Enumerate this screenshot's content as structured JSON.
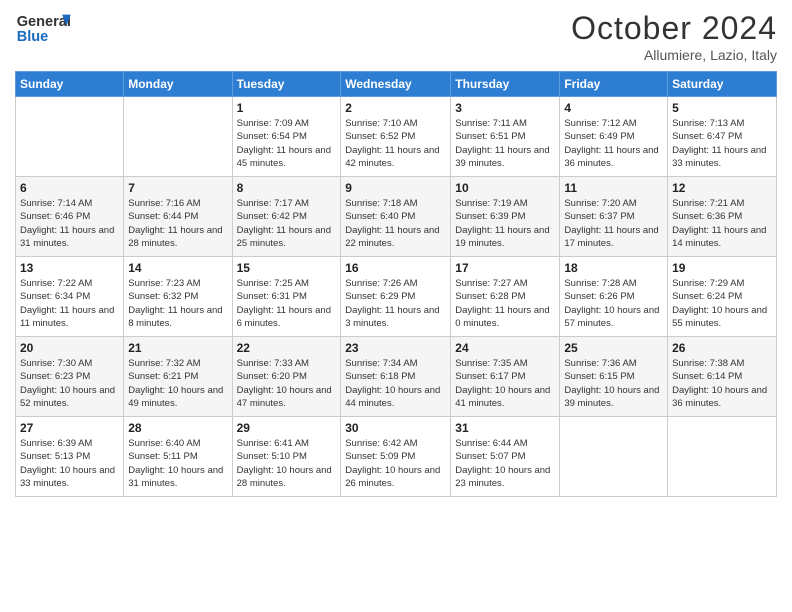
{
  "logo": {
    "line1": "General",
    "line2": "Blue"
  },
  "title": "October 2024",
  "subtitle": "Allumiere, Lazio, Italy",
  "weekdays": [
    "Sunday",
    "Monday",
    "Tuesday",
    "Wednesday",
    "Thursday",
    "Friday",
    "Saturday"
  ],
  "weeks": [
    [
      {
        "day": "",
        "info": ""
      },
      {
        "day": "",
        "info": ""
      },
      {
        "day": "1",
        "info": "Sunrise: 7:09 AM\nSunset: 6:54 PM\nDaylight: 11 hours and 45 minutes."
      },
      {
        "day": "2",
        "info": "Sunrise: 7:10 AM\nSunset: 6:52 PM\nDaylight: 11 hours and 42 minutes."
      },
      {
        "day": "3",
        "info": "Sunrise: 7:11 AM\nSunset: 6:51 PM\nDaylight: 11 hours and 39 minutes."
      },
      {
        "day": "4",
        "info": "Sunrise: 7:12 AM\nSunset: 6:49 PM\nDaylight: 11 hours and 36 minutes."
      },
      {
        "day": "5",
        "info": "Sunrise: 7:13 AM\nSunset: 6:47 PM\nDaylight: 11 hours and 33 minutes."
      }
    ],
    [
      {
        "day": "6",
        "info": "Sunrise: 7:14 AM\nSunset: 6:46 PM\nDaylight: 11 hours and 31 minutes."
      },
      {
        "day": "7",
        "info": "Sunrise: 7:16 AM\nSunset: 6:44 PM\nDaylight: 11 hours and 28 minutes."
      },
      {
        "day": "8",
        "info": "Sunrise: 7:17 AM\nSunset: 6:42 PM\nDaylight: 11 hours and 25 minutes."
      },
      {
        "day": "9",
        "info": "Sunrise: 7:18 AM\nSunset: 6:40 PM\nDaylight: 11 hours and 22 minutes."
      },
      {
        "day": "10",
        "info": "Sunrise: 7:19 AM\nSunset: 6:39 PM\nDaylight: 11 hours and 19 minutes."
      },
      {
        "day": "11",
        "info": "Sunrise: 7:20 AM\nSunset: 6:37 PM\nDaylight: 11 hours and 17 minutes."
      },
      {
        "day": "12",
        "info": "Sunrise: 7:21 AM\nSunset: 6:36 PM\nDaylight: 11 hours and 14 minutes."
      }
    ],
    [
      {
        "day": "13",
        "info": "Sunrise: 7:22 AM\nSunset: 6:34 PM\nDaylight: 11 hours and 11 minutes."
      },
      {
        "day": "14",
        "info": "Sunrise: 7:23 AM\nSunset: 6:32 PM\nDaylight: 11 hours and 8 minutes."
      },
      {
        "day": "15",
        "info": "Sunrise: 7:25 AM\nSunset: 6:31 PM\nDaylight: 11 hours and 6 minutes."
      },
      {
        "day": "16",
        "info": "Sunrise: 7:26 AM\nSunset: 6:29 PM\nDaylight: 11 hours and 3 minutes."
      },
      {
        "day": "17",
        "info": "Sunrise: 7:27 AM\nSunset: 6:28 PM\nDaylight: 11 hours and 0 minutes."
      },
      {
        "day": "18",
        "info": "Sunrise: 7:28 AM\nSunset: 6:26 PM\nDaylight: 10 hours and 57 minutes."
      },
      {
        "day": "19",
        "info": "Sunrise: 7:29 AM\nSunset: 6:24 PM\nDaylight: 10 hours and 55 minutes."
      }
    ],
    [
      {
        "day": "20",
        "info": "Sunrise: 7:30 AM\nSunset: 6:23 PM\nDaylight: 10 hours and 52 minutes."
      },
      {
        "day": "21",
        "info": "Sunrise: 7:32 AM\nSunset: 6:21 PM\nDaylight: 10 hours and 49 minutes."
      },
      {
        "day": "22",
        "info": "Sunrise: 7:33 AM\nSunset: 6:20 PM\nDaylight: 10 hours and 47 minutes."
      },
      {
        "day": "23",
        "info": "Sunrise: 7:34 AM\nSunset: 6:18 PM\nDaylight: 10 hours and 44 minutes."
      },
      {
        "day": "24",
        "info": "Sunrise: 7:35 AM\nSunset: 6:17 PM\nDaylight: 10 hours and 41 minutes."
      },
      {
        "day": "25",
        "info": "Sunrise: 7:36 AM\nSunset: 6:15 PM\nDaylight: 10 hours and 39 minutes."
      },
      {
        "day": "26",
        "info": "Sunrise: 7:38 AM\nSunset: 6:14 PM\nDaylight: 10 hours and 36 minutes."
      }
    ],
    [
      {
        "day": "27",
        "info": "Sunrise: 6:39 AM\nSunset: 5:13 PM\nDaylight: 10 hours and 33 minutes."
      },
      {
        "day": "28",
        "info": "Sunrise: 6:40 AM\nSunset: 5:11 PM\nDaylight: 10 hours and 31 minutes."
      },
      {
        "day": "29",
        "info": "Sunrise: 6:41 AM\nSunset: 5:10 PM\nDaylight: 10 hours and 28 minutes."
      },
      {
        "day": "30",
        "info": "Sunrise: 6:42 AM\nSunset: 5:09 PM\nDaylight: 10 hours and 26 minutes."
      },
      {
        "day": "31",
        "info": "Sunrise: 6:44 AM\nSunset: 5:07 PM\nDaylight: 10 hours and 23 minutes."
      },
      {
        "day": "",
        "info": ""
      },
      {
        "day": "",
        "info": ""
      }
    ]
  ]
}
